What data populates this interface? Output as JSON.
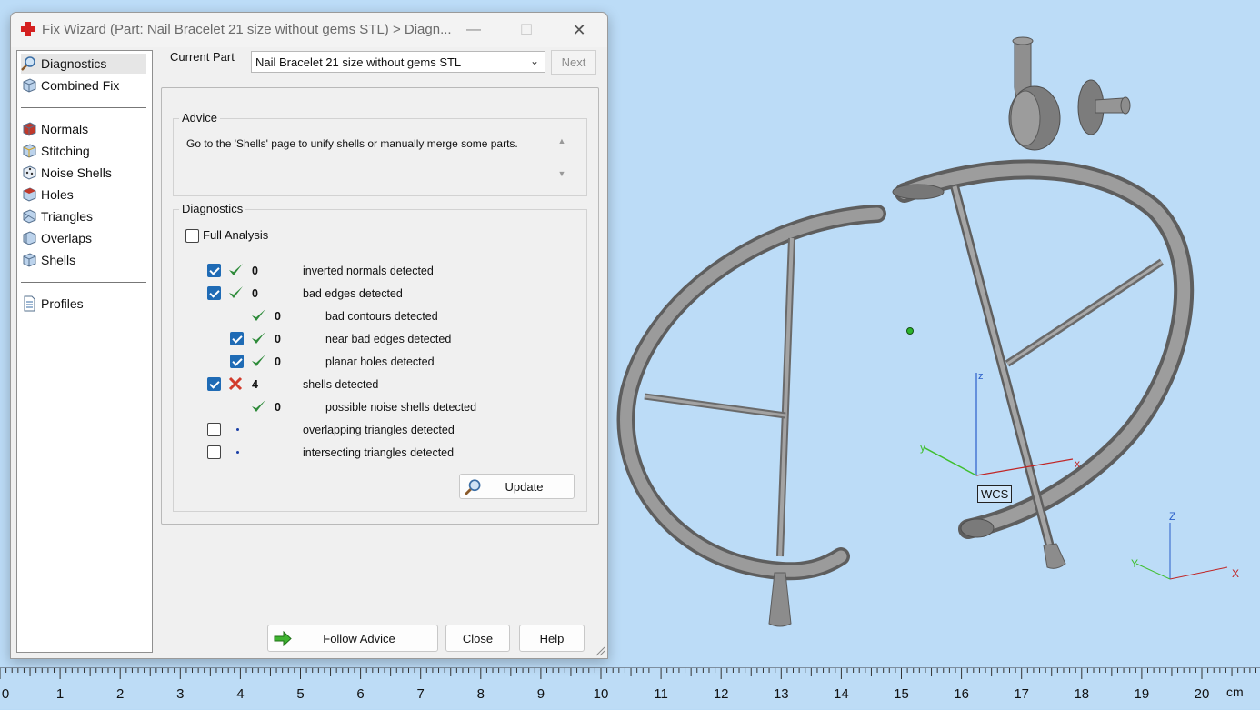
{
  "window": {
    "title": "Fix Wizard (Part: Nail Bracelet 21 size without gems STL) > Diagn...",
    "minimize": "—",
    "maximize": "☐",
    "close": "✕"
  },
  "nav": {
    "items": [
      {
        "label": "Diagnostics",
        "icon": "magnifier-icon",
        "selected": true
      },
      {
        "label": "Combined Fix",
        "icon": "cube-icon"
      },
      {
        "label": "Normals",
        "icon": "normals-cube-icon"
      },
      {
        "label": "Stitching",
        "icon": "stitching-cube-icon"
      },
      {
        "label": "Noise Shells",
        "icon": "noise-dice-icon"
      },
      {
        "label": "Holes",
        "icon": "holes-cube-icon"
      },
      {
        "label": "Triangles",
        "icon": "triangles-cube-icon"
      },
      {
        "label": "Overlaps",
        "icon": "overlaps-cube-icon"
      },
      {
        "label": "Shells",
        "icon": "shells-cube-icon"
      },
      {
        "label": "Profiles",
        "icon": "document-icon"
      }
    ]
  },
  "header": {
    "current_part_label": "Current Part",
    "current_part_value": "Nail Bracelet 21 size without gems STL",
    "next_label": "Next"
  },
  "advice": {
    "title": "Advice",
    "text": "Go to the 'Shells' page to unify shells or manually merge some parts."
  },
  "diagnostics": {
    "title": "Diagnostics",
    "full_analysis_label": "Full Analysis",
    "full_analysis_checked": false,
    "rows": [
      {
        "checkbox": "checked",
        "status": "ok",
        "count": "0",
        "label": "inverted normals detected",
        "indent": 0
      },
      {
        "checkbox": "checked",
        "status": "ok",
        "count": "0",
        "label": "bad edges detected",
        "indent": 0
      },
      {
        "checkbox": "none",
        "status": "ok",
        "count": "0",
        "label": "bad contours detected",
        "indent": 1
      },
      {
        "checkbox": "checked",
        "status": "ok",
        "count": "0",
        "label": "near bad edges detected",
        "indent": 1
      },
      {
        "checkbox": "checked",
        "status": "ok",
        "count": "0",
        "label": "planar holes detected",
        "indent": 1
      },
      {
        "checkbox": "checked",
        "status": "error",
        "count": "4",
        "label": "shells detected",
        "indent": 0
      },
      {
        "checkbox": "none",
        "status": "ok",
        "count": "0",
        "label": "possible noise shells detected",
        "indent": 1
      },
      {
        "checkbox": "unchecked",
        "status": "dot",
        "count": "",
        "label": "overlapping triangles detected",
        "indent": 0
      },
      {
        "checkbox": "unchecked",
        "status": "dot",
        "count": "",
        "label": "intersecting triangles detected",
        "indent": 0
      }
    ],
    "update_label": "Update"
  },
  "footer": {
    "follow_advice_label": "Follow Advice",
    "close_label": "Close",
    "help_label": "Help"
  },
  "viewport": {
    "wcs_label": "WCS",
    "axis_x": "x",
    "axis_y": "y",
    "axis_z": "z",
    "mini_axis_x": "X",
    "mini_axis_y": "Y",
    "mini_axis_z": "Z"
  },
  "ruler": {
    "labels": [
      "0",
      "1",
      "2",
      "3",
      "4",
      "5",
      "6",
      "7",
      "8",
      "9",
      "10",
      "11",
      "12",
      "13",
      "14",
      "15",
      "16",
      "17",
      "18",
      "19",
      "20"
    ],
    "unit": "cm"
  },
  "colors": {
    "viewport_bg": "#bcdcf7",
    "ok_check": "#2e8b3a",
    "error_x": "#d23b2b",
    "checkbox_blue": "#1f6bb5",
    "model_gray": "#8a8a8a"
  }
}
